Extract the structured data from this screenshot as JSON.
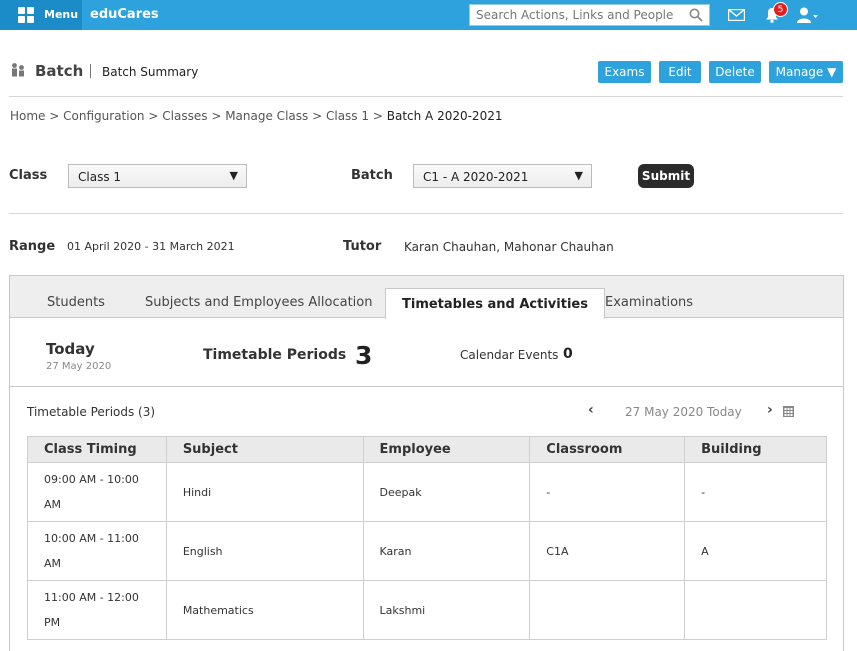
{
  "topbar": {
    "menu_label": "Menu",
    "brand": "eduCares",
    "search_placeholder": "Search Actions, Links and People",
    "notification_count": "5",
    "accent_color": "#2ea2dd"
  },
  "header": {
    "title": "Batch",
    "subtitle": "Batch Summary",
    "buttons": {
      "exams": "Exams",
      "edit": "Edit",
      "delete": "Delete",
      "manage": "Manage ▼"
    }
  },
  "breadcrumb": {
    "items": [
      "Home",
      "Configuration",
      "Classes",
      "Manage Class",
      "Class 1"
    ],
    "separator": ">",
    "current": "Batch A 2020-2021"
  },
  "filters": {
    "class_label": "Class",
    "class_value": "Class 1",
    "batch_label": "Batch",
    "batch_value": "C1 - A 2020-2021",
    "submit_label": "Submit"
  },
  "info": {
    "range_label": "Range",
    "range_value": "01 April 2020 - 31 March 2021",
    "tutor_label": "Tutor",
    "tutor_value": "Karan Chauhan, Mahonar Chauhan"
  },
  "tabs": [
    {
      "label": "Students",
      "active": false
    },
    {
      "label": "Subjects and Employees Allocation",
      "active": false
    },
    {
      "label": "Timetables and Activities",
      "active": true
    },
    {
      "label": "Examinations",
      "active": false
    }
  ],
  "summary": {
    "today_label": "Today",
    "today_date": "27 May 2020",
    "periods_label": "Timetable Periods",
    "periods_count": "3",
    "events_label": "Calendar Events",
    "events_count": "0"
  },
  "timetable": {
    "title": "Timetable Periods (3)",
    "nav_prev": "‹",
    "nav_next": "›",
    "nav_date": "27 May 2020 Today",
    "columns": [
      "Class Timing",
      "Subject",
      "Employee",
      "Classroom",
      "Building"
    ],
    "rows": [
      [
        "09:00 AM - 10:00 AM",
        "Hindi",
        "Deepak",
        "-",
        "-"
      ],
      [
        "10:00 AM - 11:00 AM",
        "English",
        "Karan",
        "C1A",
        "A"
      ],
      [
        "11:00 AM - 12:00 PM",
        "Mathematics",
        "Lakshmi",
        "",
        ""
      ]
    ]
  }
}
